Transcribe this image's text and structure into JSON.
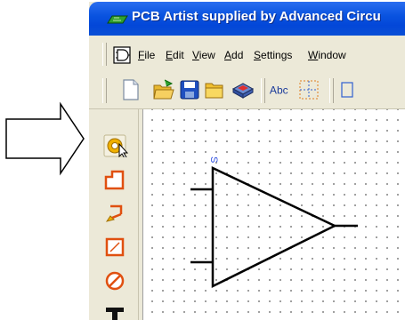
{
  "window": {
    "title": "PCB Artist supplied by Advanced Circu"
  },
  "menu": {
    "items": [
      "File",
      "Edit",
      "View",
      "Add",
      "Settings",
      "Window"
    ]
  },
  "toolbar": {
    "text_button_label": "Abc"
  },
  "component": {
    "label": "S"
  },
  "icons": {
    "arrow": "hollow-right-arrow",
    "title": "pcb-board-icon",
    "menu_doc": "document-icon",
    "toolbar": [
      "new-document-icon",
      "open-folder-icon",
      "save-icon",
      "folder-icon",
      "library-icon",
      "text-icon",
      "grid-icon"
    ],
    "left": [
      "select-pad-icon",
      "add-shape-icon",
      "add-line-icon",
      "add-rect-icon",
      "add-circle-icon",
      "add-text-icon"
    ]
  },
  "colors": {
    "titlebar": "#0a54e0",
    "tool_orange": "#e06010",
    "pad_gold": "#e0a000",
    "save_blue": "#2050c0"
  }
}
